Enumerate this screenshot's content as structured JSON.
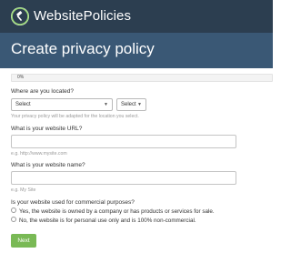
{
  "header": {
    "brand": "WebsitePolicies",
    "logo_icon": "gavel-icon"
  },
  "page": {
    "title": "Create privacy policy"
  },
  "progress": {
    "label": "0%",
    "fraction": 0.0,
    "fill_color": "#9ddc79"
  },
  "form": {
    "location": {
      "question": "Where are you located?",
      "country_select": "Select",
      "region_select": "Select",
      "hint": "Your privacy policy will be adapted for the location you select."
    },
    "url": {
      "question": "What is your website URL?",
      "value": "",
      "hint": "e.g. http://www.mysite.com"
    },
    "name": {
      "question": "What is your website name?",
      "value": "",
      "hint": "e.g. My Site"
    },
    "commercial": {
      "question": "Is your website used for commercial purposes?",
      "options": [
        "Yes, the website is owned by a company or has products or services for sale.",
        "No, the website is for personal use only and is 100% non-commercial."
      ]
    },
    "next_label": "Next"
  },
  "colors": {
    "topbar": "#2c3e50",
    "hero": "#3a5875",
    "button": "#79b955"
  }
}
